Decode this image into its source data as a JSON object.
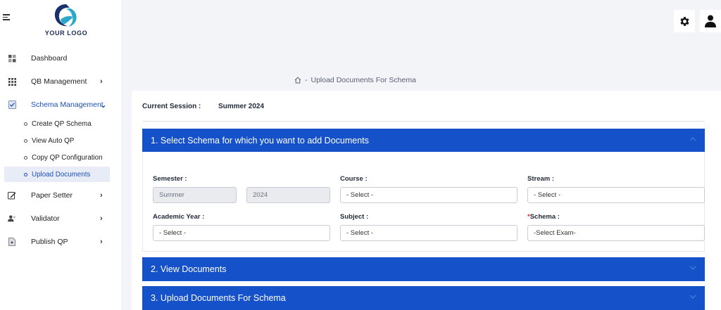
{
  "sidebar": {
    "logo_text": "YOUR LOGO",
    "items": [
      {
        "label": "Dashboard",
        "icon": "dashboard-icon"
      },
      {
        "label": "QB Management",
        "icon": "grid-icon",
        "chevron": "›"
      },
      {
        "label": "Schema Management",
        "icon": "checklist-icon",
        "chevron": "⌄"
      },
      {
        "label": "Paper Setter",
        "icon": "pencil-icon",
        "chevron": "›"
      },
      {
        "label": "Validator",
        "icon": "users-icon",
        "chevron": "›"
      },
      {
        "label": "Publish QP",
        "icon": "document-icon",
        "chevron": "›"
      }
    ],
    "sub_items": [
      {
        "label": "Create QP Schema"
      },
      {
        "label": "View Auto QP"
      },
      {
        "label": "Copy QP Configuration"
      },
      {
        "label": "Upload Documents"
      }
    ]
  },
  "header": {
    "settings_icon": "gear-icon",
    "user_icon": "user-icon"
  },
  "breadcrumb": {
    "home_icon": "home-icon",
    "separator": "-",
    "current": "Upload Documents For Schema"
  },
  "session": {
    "label": "Current Session :",
    "value": "Summer 2024"
  },
  "accordion": {
    "section1": "1. Select Schema for which you want to add Documents",
    "section2": "2. View Documents",
    "section3": "3. Upload Documents For Schema"
  },
  "form": {
    "semester_label": "Semester :",
    "semester_season": "Summer",
    "semester_year": "2024",
    "course_label": "Course :",
    "course_value": "- Select -",
    "stream_label": "Stream :",
    "stream_value": "- Select -",
    "academic_year_label": "Academic Year :",
    "academic_year_value": "- Select -",
    "subject_label": "Subject :",
    "subject_value": "- Select -",
    "schema_required": "*",
    "schema_label": "Schema :",
    "schema_value": "-Select Exam-"
  },
  "colors": {
    "accent": "#1551c9",
    "active_text": "#1c4fb8",
    "page_bg": "#f3f4f8"
  }
}
